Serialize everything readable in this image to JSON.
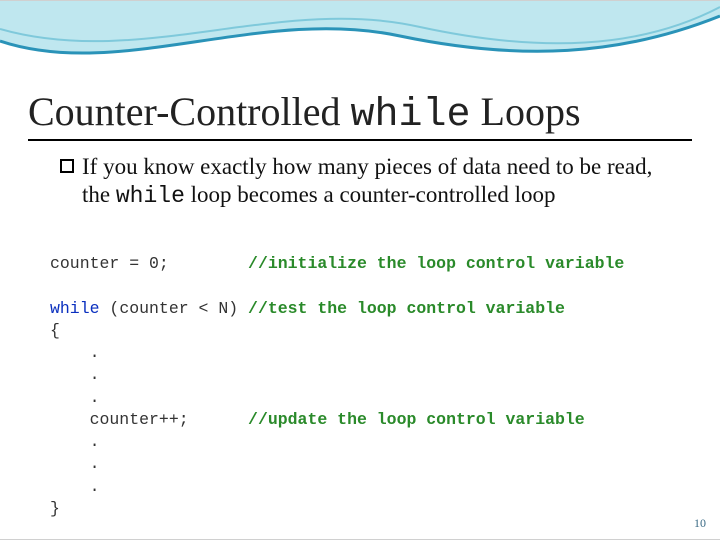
{
  "title": {
    "pre": "Counter-Controlled ",
    "mono": "while",
    "post": " Loops"
  },
  "body": {
    "pre": "If you know exactly how many pieces of data need to be read, the ",
    "mono": "while",
    "post": " loop becomes a counter-controlled loop"
  },
  "code": {
    "l1a": "counter = 0;        ",
    "l1c": "//initialize the loop control variable",
    "blank1": "",
    "l2k": "while",
    "l2a": " (counter < N) ",
    "l2c": "//test the loop control variable",
    "l3": "{",
    "l4": "    .",
    "l5": "    .",
    "l6": "    .",
    "l7a": "    counter++;      ",
    "l7c": "//update the loop control variable",
    "l8": "    .",
    "l9": "    .",
    "l10": "    .",
    "l11": "}"
  },
  "page": "10"
}
